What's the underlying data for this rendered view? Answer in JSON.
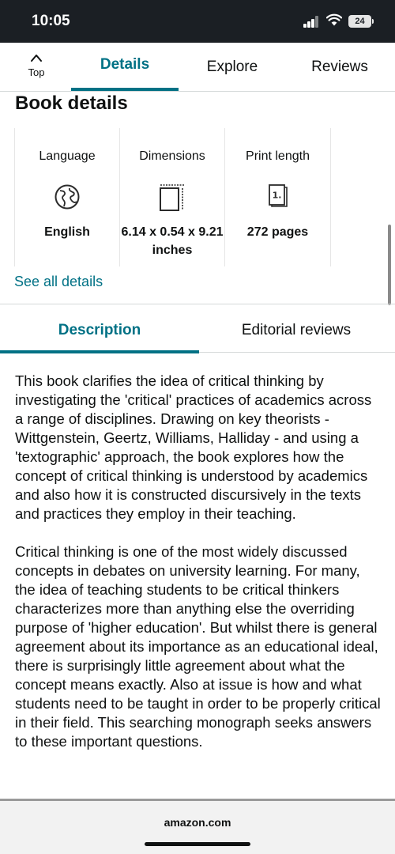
{
  "status_bar": {
    "time": "10:05",
    "battery": "24",
    "icons": [
      "signal-icon",
      "wifi-icon",
      "battery-icon"
    ]
  },
  "nav": {
    "top_label": "Top",
    "tabs": [
      {
        "label": "Details",
        "active": true
      },
      {
        "label": "Explore",
        "active": false
      },
      {
        "label": "Reviews",
        "active": false
      }
    ]
  },
  "book_details": {
    "title": "Book details",
    "cards": [
      {
        "label": "Language",
        "value": "English",
        "icon": "globe-icon"
      },
      {
        "label": "Dimensions",
        "value": "6.14 x 0.54 x 9.21 inches",
        "icon": "dimensions-icon"
      },
      {
        "label": "Print length",
        "value": "272 pages",
        "icon": "book-pages-icon"
      }
    ],
    "see_all": "See all details"
  },
  "content_tabs": [
    {
      "label": "Description",
      "active": true
    },
    {
      "label": "Editorial reviews",
      "active": false
    }
  ],
  "description": {
    "paragraphs": [
      "This book clarifies the idea of critical thinking by investigating the 'critical' practices of academics across a range of disciplines. Drawing on key theorists - Wittgenstein, Geertz, Williams, Halliday - and using a 'textographic' approach, the book explores how the concept of critical thinking is understood by academics and also how it is constructed discursively in the texts and practices they employ in their teaching.",
      "Critical thinking is one of the most widely discussed concepts in debates on university learning. For many, the idea of teaching students to be critical thinkers characterizes more than anything else the overriding purpose of 'higher education'. But whilst there is general agreement about its importance as an educational ideal, there is surprisingly little agreement about what the concept means exactly. Also at issue is how and what students need to be taught in order to be properly critical in their field. This searching monograph seeks answers to these important questions."
    ]
  },
  "browser": {
    "url": "amazon.com"
  },
  "colors": {
    "accent": "#007185",
    "status_bar": "#1b1f24",
    "text": "#0f1111"
  }
}
